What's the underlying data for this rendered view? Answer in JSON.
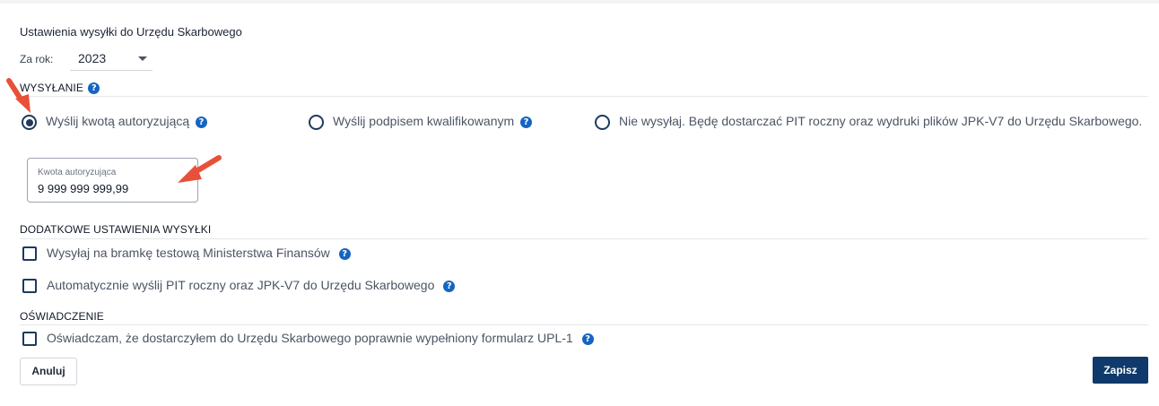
{
  "header": {
    "title": "Ustawienia wysyłki do Urzędu Skarbowego",
    "year_label": "Za rok:",
    "year_value": "2023"
  },
  "sending": {
    "heading": "WYSYŁANIE",
    "options": [
      {
        "label": "Wyślij kwotą autoryzującą",
        "selected": true,
        "has_help": true
      },
      {
        "label": "Wyślij podpisem kwalifikowanym",
        "selected": false,
        "has_help": true
      },
      {
        "label": "Nie wysyłaj. Będę dostarczać PIT roczny oraz wydruki plików JPK-V7 do Urzędu Skarbowego.",
        "selected": false,
        "has_help": false
      }
    ],
    "amount": {
      "label": "Kwota autoryzująca",
      "value": "9 999 999 999,99"
    }
  },
  "additional": {
    "heading": "DODATKOWE USTAWIENIA WYSYŁKI",
    "items": [
      {
        "label": "Wysyłaj na bramkę testową Ministerstwa Finansów",
        "checked": false
      },
      {
        "label": "Automatycznie wyślij PIT roczny oraz JPK-V7 do Urzędu Skarbowego",
        "checked": false
      }
    ]
  },
  "declaration": {
    "heading": "OŚWIADCZENIE",
    "items": [
      {
        "label": "Oświadczam, że dostarczyłem do Urzędu Skarbowego poprawnie wypełniony formularz UPL-1",
        "checked": false
      }
    ]
  },
  "actions": {
    "cancel_label": "Anuluj",
    "save_label": "Zapisz"
  },
  "icons": {
    "help": "question-circle-icon",
    "annotation": "red-arrow-icon"
  },
  "colors": {
    "accent": "#1e3a5f",
    "help_blue": "#1565c0",
    "save_button": "#0f3a6b",
    "annotation_arrow": "#e8503a"
  }
}
